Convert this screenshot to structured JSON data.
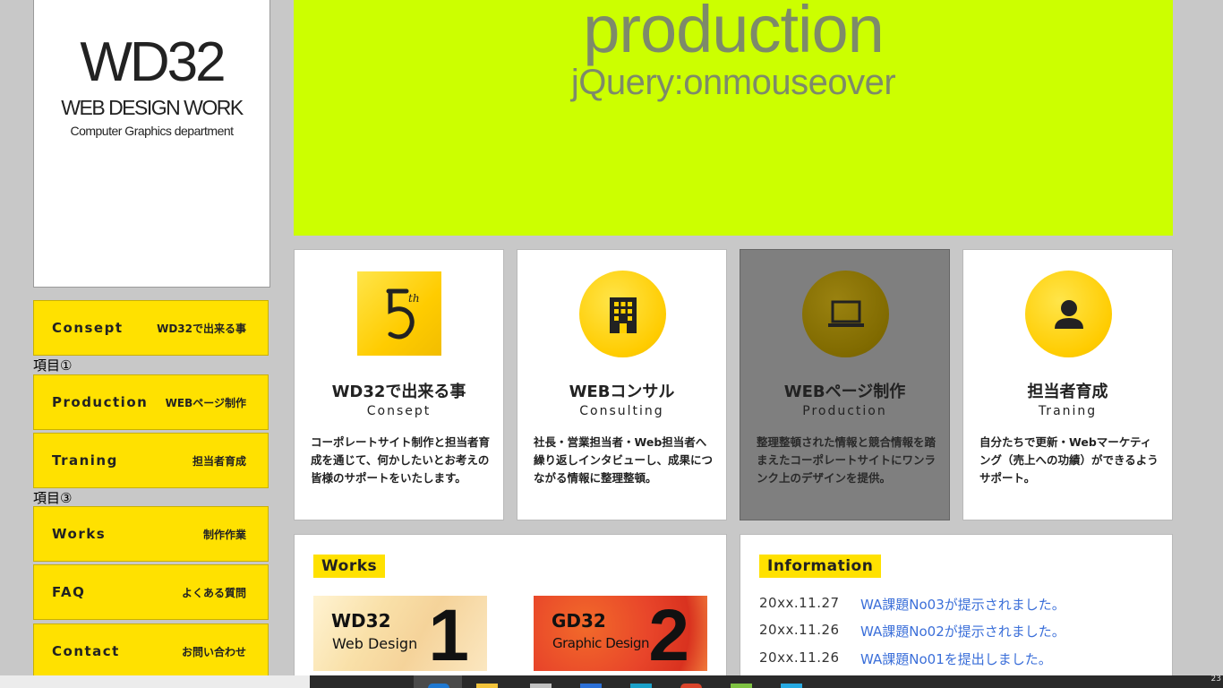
{
  "logo": {
    "title": "WD32",
    "subtitle": "WEB DESIGN WORK",
    "department": "Computer Graphics department"
  },
  "sidebar": {
    "items": [
      {
        "en": "Consept",
        "ja": "WD32で出来る事"
      },
      {
        "en": "Production",
        "ja": "WEBページ制作"
      },
      {
        "en": "Traning",
        "ja": "担当者育成"
      },
      {
        "en": "Works",
        "ja": "制作作業"
      },
      {
        "en": "FAQ",
        "ja": "よくある質問"
      },
      {
        "en": "Contact",
        "ja": "お問い合わせ"
      }
    ],
    "labels": [
      "項目①",
      "項目③"
    ]
  },
  "hero": {
    "title": "production",
    "subtitle": "jQuery:onmouseover",
    "color": "#ccff00"
  },
  "cards": [
    {
      "title": "WD32で出来る事",
      "en": "Consept",
      "desc": "コーポレートサイト制作と担当者育成を通じて、何かしたいとお考えの皆様のサポートをいたします。",
      "icon": "five-badge-icon"
    },
    {
      "title": "WEBコンサル",
      "en": "Consulting",
      "desc": "社長・営業担当者・Web担当者へ繰り返しインタビューし、成果につながる情報に整理整頓。",
      "icon": "building-icon"
    },
    {
      "title": "WEBページ制作",
      "en": "Production",
      "desc": "整理整頓された情報と競合情報を踏まえたコーポレートサイトにワンランク上のデザインを提供。",
      "icon": "laptop-icon"
    },
    {
      "title": "担当者育成",
      "en": "Traning",
      "desc": "自分たちで更新・Webマーケティング（売上への功績）ができるようサポート。",
      "icon": "person-icon"
    }
  ],
  "works": {
    "heading": "Works",
    "items": [
      {
        "label": "WD32",
        "sub": "Web Design",
        "num": "1"
      },
      {
        "label": "GD32",
        "sub": "Graphic Design",
        "num": "2"
      }
    ]
  },
  "information": {
    "heading": "Information",
    "items": [
      {
        "date": "20xx.11.27",
        "text": "WA課題No03が提示されました。"
      },
      {
        "date": "20xx.11.26",
        "text": "WA課題No02が提示されました。"
      },
      {
        "date": "20xx.11.26",
        "text": "WA課題No01を提出しました。"
      }
    ]
  },
  "taskbar": {
    "clock": "23"
  },
  "colors": {
    "accent_yellow": "#ffe100",
    "hero_green": "#ccff00",
    "link_blue": "#3b6fd9"
  }
}
